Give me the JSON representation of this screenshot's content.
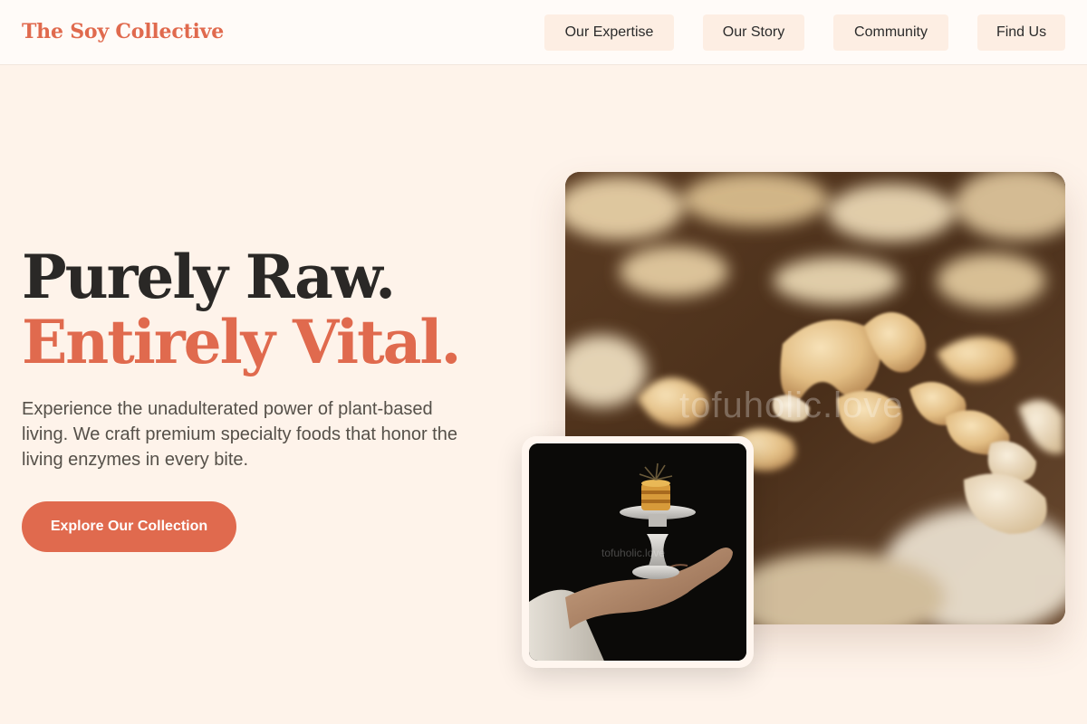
{
  "brand": "The Soy Collective",
  "nav": {
    "items": [
      {
        "label": "Our Expertise"
      },
      {
        "label": "Our Story"
      },
      {
        "label": "Community"
      },
      {
        "label": "Find Us"
      }
    ]
  },
  "hero": {
    "title_line1": "Purely Raw.",
    "title_line2": "Entirely Vital.",
    "description": "Experience the unadulterated power of plant-based living. We craft premium specialty foods that honor the living enzymes in every bite.",
    "cta_label": "Explore Our Collection"
  },
  "images": {
    "main_watermark": "tofuholic.love",
    "sub_watermark": "tofuholic.love"
  },
  "colors": {
    "accent": "#e06a4e",
    "background": "#fef3ea",
    "nav_button": "#fdeee3",
    "heading_dark": "#2a2826"
  }
}
